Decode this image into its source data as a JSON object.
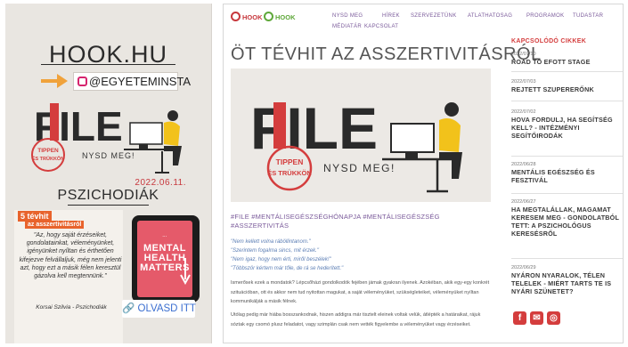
{
  "story": {
    "logo": "HOOK.HU",
    "handle": "@EGYETEMINSTA",
    "art_word": "FILE",
    "art_sub": "NYSD MEG!",
    "art_stamp_top": "TIPPEN",
    "art_stamp_bottom": "ÉS TRÜKKÖN",
    "date": "2022.06.11.",
    "title": "PSZICHODIÁK",
    "badge_main": "5 tévhit",
    "badge_sub": "az asszertivitásról",
    "quote": "\"Az, hogy saját érzéseiket, gondolatainkat, véleményünket, igényünket nyíltan és érthetően kifejezve felvállaljuk, még nem jelenti azt, hogy ezt a másik félen keresztül gázolva kell megtennünk.\"",
    "author": "Korsai Szilvia - Pszichodiák",
    "book_small": "...",
    "book_text": "MENTAL HEALTH MATTERS",
    "olvasd": "OLVASD ITT"
  },
  "site": {
    "brand1": "HOOK",
    "brand2": "HOOK",
    "nav": [
      "NYSD MEG",
      "HÍREK",
      "SZERVEZETÜNK",
      "ATLATHATOSAG",
      "PROGRAMOK",
      "TUDASTAR"
    ],
    "nav2": [
      "MÉDIATÁR",
      "KAPCSOLAT"
    ],
    "title": "ÖT TÉVHIT AZ ASSZERTIVITÁSRÓL",
    "tags": "#FILE #MENTÁLISEGÉSZSÉGHÓNAPJA #MENTÁLISEGÉSZSÉG #ASSZERTIVITÁS",
    "quotes": [
      "\"Nem kellett volna ráböllintanom.\"",
      "\"Szerintem fogalma sincs, mit érzek.\"",
      "\"Nem igaz, hogy nem érti, miről beszélek!\"",
      "\"Többször kértem már tőle, de rá se hederített.\""
    ],
    "para1": "Ismerősek ezek a mondatok? Lépcsőházi gondolkodók fejében jámak gyakran ilyenek. Azokéban, akik egy-egy konkrét szituációban, ott és akkor nem tud nyitottan magukat, a saját véleményüket, szükségleteiket, véleményüket nyíltan kommunikálják a másik félnek.",
    "para2": "Utólag pedig már hiába bosszankodnak, hiszen addigra már tisztelt eleinek voltak velük, átlépték a határaikat, rájuk sóztak egy csomó plusz feladatot, vagy szimplán csak nem vették figyelembe a véleményüket vagy érzéseiket.",
    "sidebar_head": "KAPCSOLÓDÓ CIKKEK",
    "sidebar": [
      {
        "date": "2022/07/10",
        "title": "ROAD TO EFOTT STAGE"
      },
      {
        "date": "2022/07/03",
        "title": "REJTETT SZUPERERŐNK"
      },
      {
        "date": "2022/07/02",
        "title": "HOVA FORDULJ, HA SEGÍTSÉG KELL? - INTÉZMÉNYI SEGÍTŐIRODÁK"
      },
      {
        "date": "2022/06/28",
        "title": "MENTÁLIS EGÉSZSÉG ÉS FESZTIVÁL"
      },
      {
        "date": "2022/06/27",
        "title": "HA MEGTALÁLLAK, MAGAMAT KERESEM MEG - GONDOLATBÓL TETT: A PSZICHOLÓGUS KERESÉSRŐL"
      },
      {
        "date": "2022/06/29",
        "title": "NYÁRON NYARALOK, TÉLEN TELELEK - MIÉRT TARTS TE IS NYÁRI SZÜNETET?"
      }
    ],
    "social": [
      "f",
      "✉",
      "◎"
    ]
  }
}
